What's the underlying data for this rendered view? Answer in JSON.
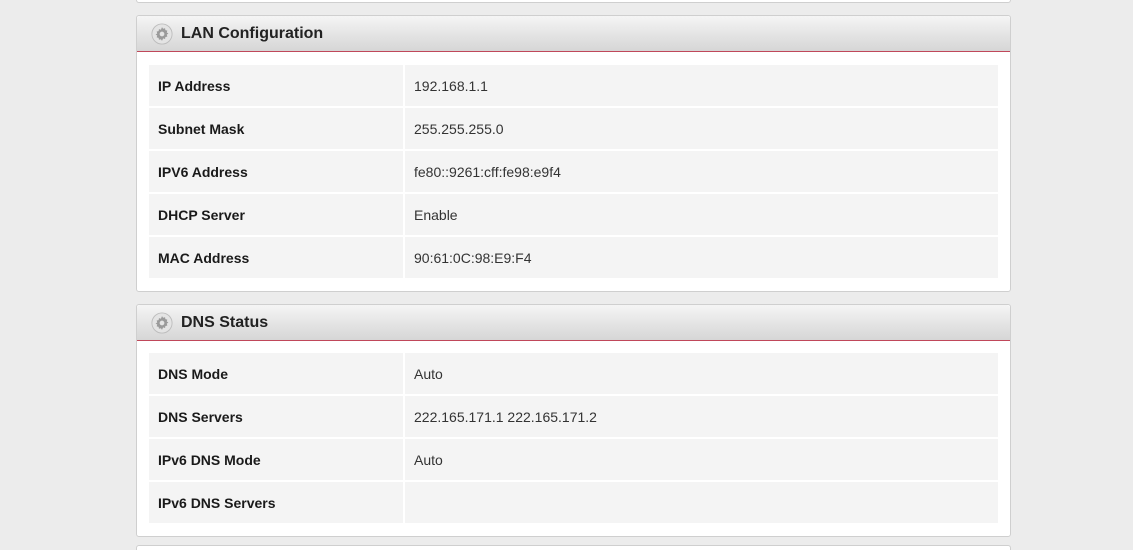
{
  "lan": {
    "title": "LAN Configuration",
    "icon": "gear-icon",
    "rows": [
      {
        "label": "IP Address",
        "value": "192.168.1.1"
      },
      {
        "label": "Subnet Mask",
        "value": "255.255.255.0"
      },
      {
        "label": "IPV6 Address",
        "value": "fe80::9261:cff:fe98:e9f4"
      },
      {
        "label": "DHCP Server",
        "value": "Enable"
      },
      {
        "label": "MAC Address",
        "value": "90:61:0C:98:E9:F4"
      }
    ]
  },
  "dns": {
    "title": "DNS Status",
    "icon": "gear-icon",
    "rows": [
      {
        "label": "DNS Mode",
        "value": "Auto"
      },
      {
        "label": "DNS Servers",
        "value": "222.165.171.1 222.165.171.2"
      },
      {
        "label": "IPv6 DNS Mode",
        "value": "Auto"
      },
      {
        "label": "IPv6 DNS Servers",
        "value": ""
      }
    ]
  },
  "colors": {
    "header_accent": "#c0485a",
    "background": "#ececec",
    "row_background": "#f4f4f4"
  }
}
